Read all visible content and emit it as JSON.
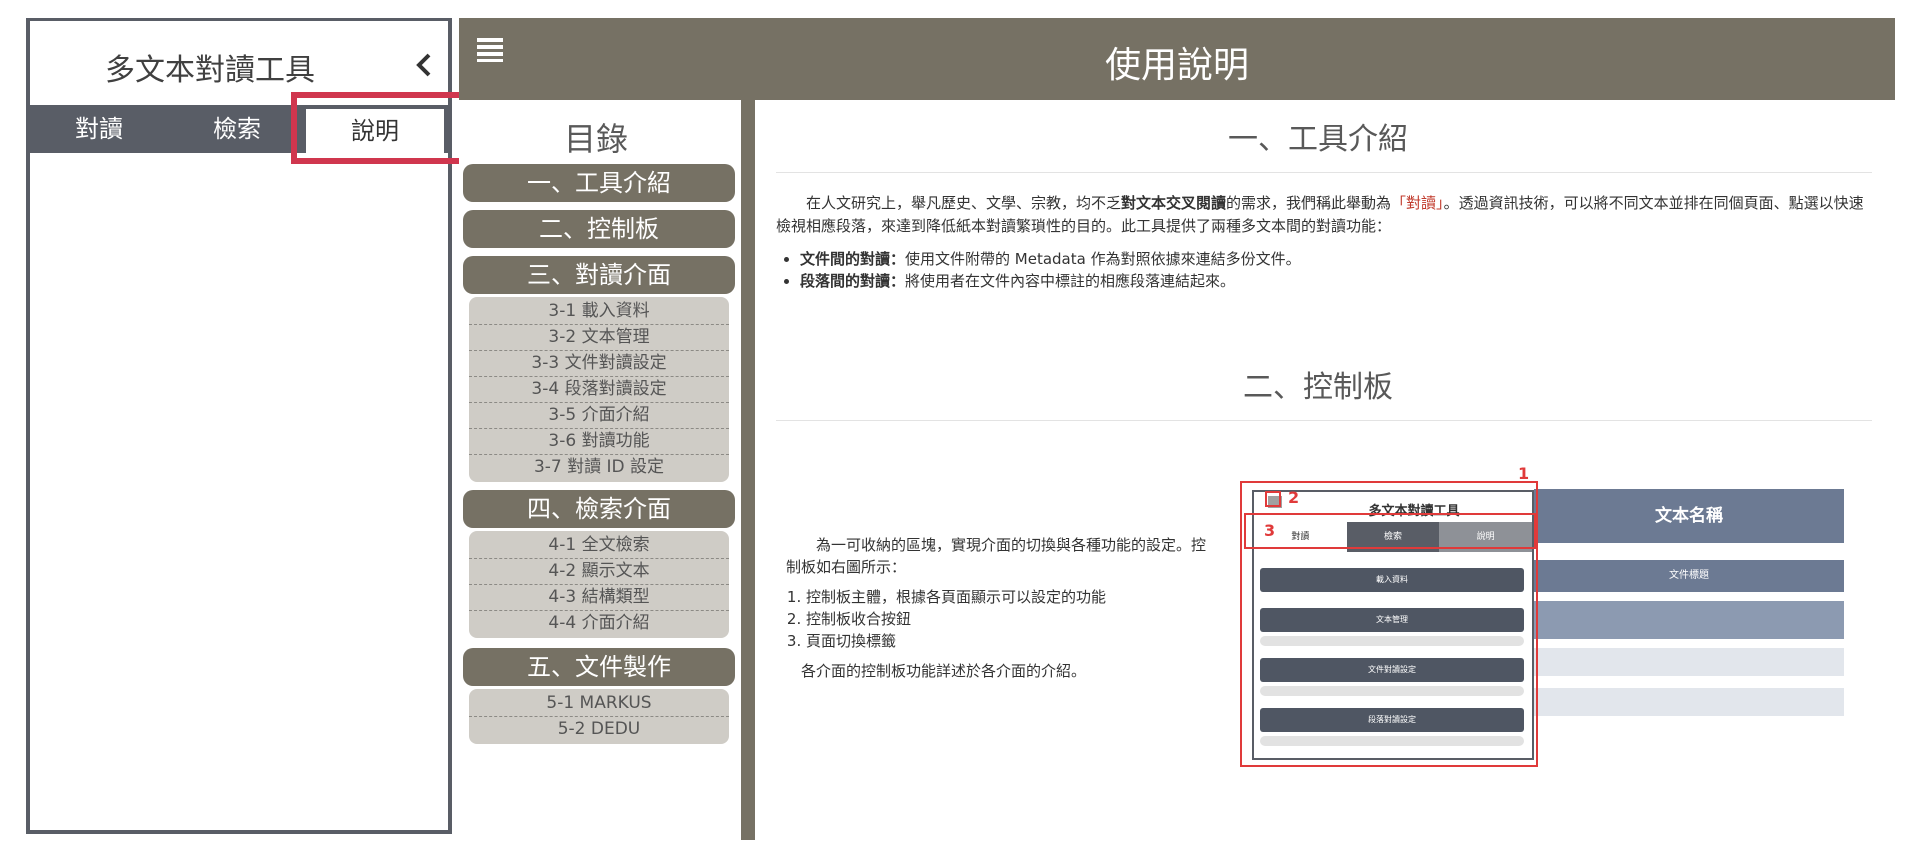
{
  "panel": {
    "title": "多文本對讀工具",
    "tabs": [
      "對讀",
      "檢索",
      "說明"
    ],
    "active_tab": "說明"
  },
  "header": {
    "title": "使用說明"
  },
  "toc": {
    "title": "目錄",
    "sections": [
      {
        "label": "一、工具介紹",
        "subs": []
      },
      {
        "label": "二、控制板",
        "subs": []
      },
      {
        "label": "三、對讀介面",
        "subs": [
          "3-1 載入資料",
          "3-2 文本管理",
          "3-3 文件對讀設定",
          "3-4 段落對讀設定",
          "3-5 介面介紹",
          "3-6 對讀功能",
          "3-7 對讀 ID 設定"
        ]
      },
      {
        "label": "四、檢索介面",
        "subs": [
          "4-1 全文檢索",
          "4-2 顯示文本",
          "4-3 結構類型",
          "4-4 介面介紹"
        ]
      },
      {
        "label": "五、文件製作",
        "subs": [
          "5-1 MARKUS",
          "5-2 DEDU"
        ]
      }
    ]
  },
  "content": {
    "sec1_title": "一、工具介紹",
    "intro_pre": "在人文研究上，舉凡歷史、文學、宗教，均不乏",
    "intro_bold": "對文本交叉閱讀",
    "intro_mid": "的需求，我們稱此舉動為",
    "intro_em": "「對讀」",
    "intro_post": "。透過資訊技術，可以將不同文本並排在同個頁面、點選以快速檢視相應段落，來達到降低紙本對讀繁瑣性的目的。此工具提供了兩種多文本間的對讀功能：",
    "bullets": [
      {
        "bold": "文件間的對讀：",
        "text": "使用文件附帶的 Metadata 作為對照依據來連結多份文件。"
      },
      {
        "bold": "段落間的對讀：",
        "text": "將使用者在文件內容中標註的相應段落連結起來。"
      }
    ],
    "sec2_title": "二、控制板",
    "ctl_desc": "為一可收納的區塊，實現介面的切換與各種功能的設定。控制板如右圖所示：",
    "ctl_list": [
      "控制板主體，根據各頁面顯示可以設定的功能",
      "控制板收合按鈕",
      "頁面切換標籤"
    ],
    "ctl_note": "各介面的控制板功能詳述於各介面的介紹。"
  },
  "diagram": {
    "title": "多文本對讀工具",
    "tabs": [
      "對讀",
      "檢索",
      "說明"
    ],
    "buttons": [
      "載入資料",
      "文本管理",
      "文件對讀設定",
      "段落對讀設定"
    ],
    "doc_header": "文本名稱",
    "doc_row": "文件標題",
    "markers": [
      "1",
      "2",
      "3"
    ]
  },
  "colors": {
    "header_bg": "#767164",
    "tab_bg": "#595d66",
    "highlight": "#d0364e",
    "toc_sub_bg": "#cfccc6"
  }
}
